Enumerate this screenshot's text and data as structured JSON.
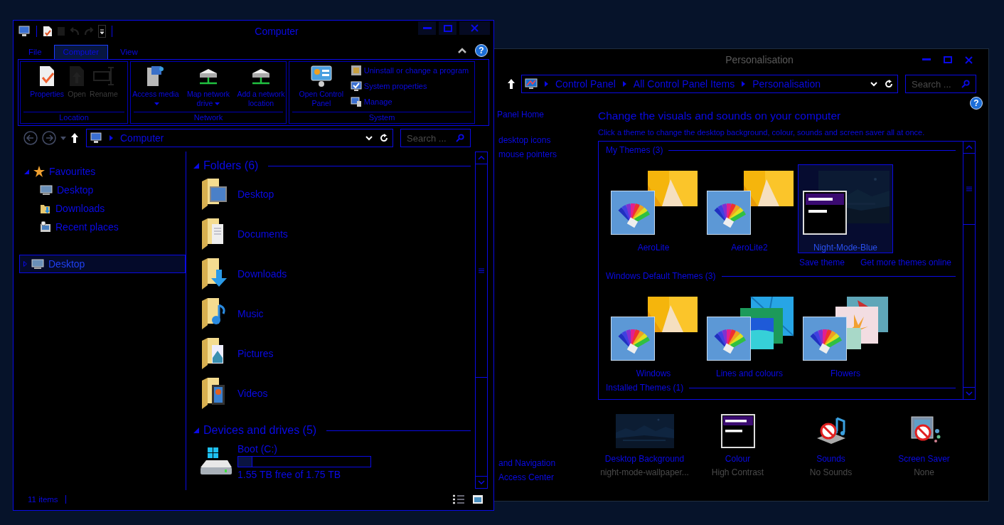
{
  "explorer": {
    "title": "Computer",
    "ribbon": {
      "tabs": [
        {
          "label": "File",
          "selected": false
        },
        {
          "label": "Computer",
          "selected": true
        },
        {
          "label": "View",
          "selected": false
        }
      ],
      "help": "?",
      "groups": [
        {
          "label": "Location",
          "commands": [
            {
              "label": "Properties",
              "kind": "large",
              "disabled": false,
              "dropdown": false
            },
            {
              "label": "Open",
              "kind": "large",
              "disabled": true,
              "dropdown": false
            },
            {
              "label": "Rename",
              "kind": "large",
              "disabled": true,
              "dropdown": false
            }
          ]
        },
        {
          "label": "Network",
          "commands": [
            {
              "label": "Access media",
              "kind": "large",
              "disabled": false,
              "dropdown": true
            },
            {
              "label": "Map network drive",
              "kind": "large",
              "disabled": false,
              "dropdown": true
            },
            {
              "label": "Add a network location",
              "kind": "large",
              "disabled": false,
              "dropdown": false
            }
          ]
        },
        {
          "label": "System",
          "commands": [
            {
              "label": "Open Control Panel",
              "kind": "large",
              "disabled": false,
              "dropdown": false
            },
            {
              "label": "Uninstall or change a program",
              "kind": "small",
              "disabled": false,
              "dropdown": false
            },
            {
              "label": "System properties",
              "kind": "small",
              "disabled": false,
              "dropdown": false
            },
            {
              "label": "Manage",
              "kind": "small",
              "disabled": false,
              "dropdown": false
            }
          ]
        }
      ]
    },
    "address": {
      "breadcrumb": [
        "Computer"
      ]
    },
    "search": {
      "placeholder": "Search ..."
    },
    "tree": [
      {
        "label": "Favourites",
        "expanded": true,
        "selected": false,
        "children": [
          {
            "label": "Desktop",
            "selected": false
          },
          {
            "label": "Downloads",
            "selected": false
          },
          {
            "label": "Recent places",
            "selected": false
          }
        ]
      },
      {
        "label": "Desktop",
        "expanded": false,
        "selected": true
      }
    ],
    "sections": [
      {
        "title": "Folders (6)",
        "expanded": true,
        "items": [
          {
            "label": "Desktop"
          },
          {
            "label": "Documents"
          },
          {
            "label": "Downloads"
          },
          {
            "label": "Music"
          },
          {
            "label": "Pictures"
          },
          {
            "label": "Videos"
          }
        ]
      },
      {
        "title": "Devices and drives (5)",
        "expanded": true,
        "drives": [
          {
            "label": "Boot (C:)",
            "level": 0.11,
            "free": "1.55 TB free of 1.75 TB"
          }
        ]
      }
    ],
    "status_bar": {
      "count": "11 items"
    }
  },
  "personalisation": {
    "title": "Personalisation",
    "address": {
      "breadcrumb": [
        "Control Panel",
        "All Control Panel Items",
        "Personalisation"
      ]
    },
    "search": {
      "placeholder": "Search ..."
    },
    "help": "?",
    "sidebar": {
      "links": [
        "Panel Home",
        "desktop icons",
        "mouse pointers"
      ],
      "see_also": [
        "and Navigation",
        "Access Center"
      ]
    },
    "heading": "Change the visuals and sounds on your computer",
    "subheading": "Click a theme to change the desktop background, colour, sounds and screen saver all at once.",
    "theme_sections": [
      {
        "title": "My Themes (3)",
        "themes": [
          {
            "name": "AeroLite",
            "kind": "palette",
            "selected": false
          },
          {
            "name": "AeroLite2",
            "kind": "palette",
            "selected": false
          },
          {
            "name": "Night-Mode-Blue",
            "kind": "high-contrast",
            "selected": true
          }
        ],
        "links": [
          "Save theme",
          "Get more themes online"
        ]
      },
      {
        "title": "Windows Default Themes (3)",
        "themes": [
          {
            "name": "Windows",
            "kind": "palette",
            "selected": false
          },
          {
            "name": "Lines and colours",
            "kind": "palette",
            "selected": false
          },
          {
            "name": "Flowers",
            "kind": "palette",
            "selected": false
          }
        ]
      },
      {
        "title": "Installed Themes (1)"
      }
    ],
    "settings": [
      {
        "label": "Desktop Background",
        "value": "night-mode-wallpaper..."
      },
      {
        "label": "Colour",
        "value": "High Contrast"
      },
      {
        "label": "Sounds",
        "value": "No Sounds"
      },
      {
        "label": "Screen Saver",
        "value": "None"
      }
    ]
  }
}
